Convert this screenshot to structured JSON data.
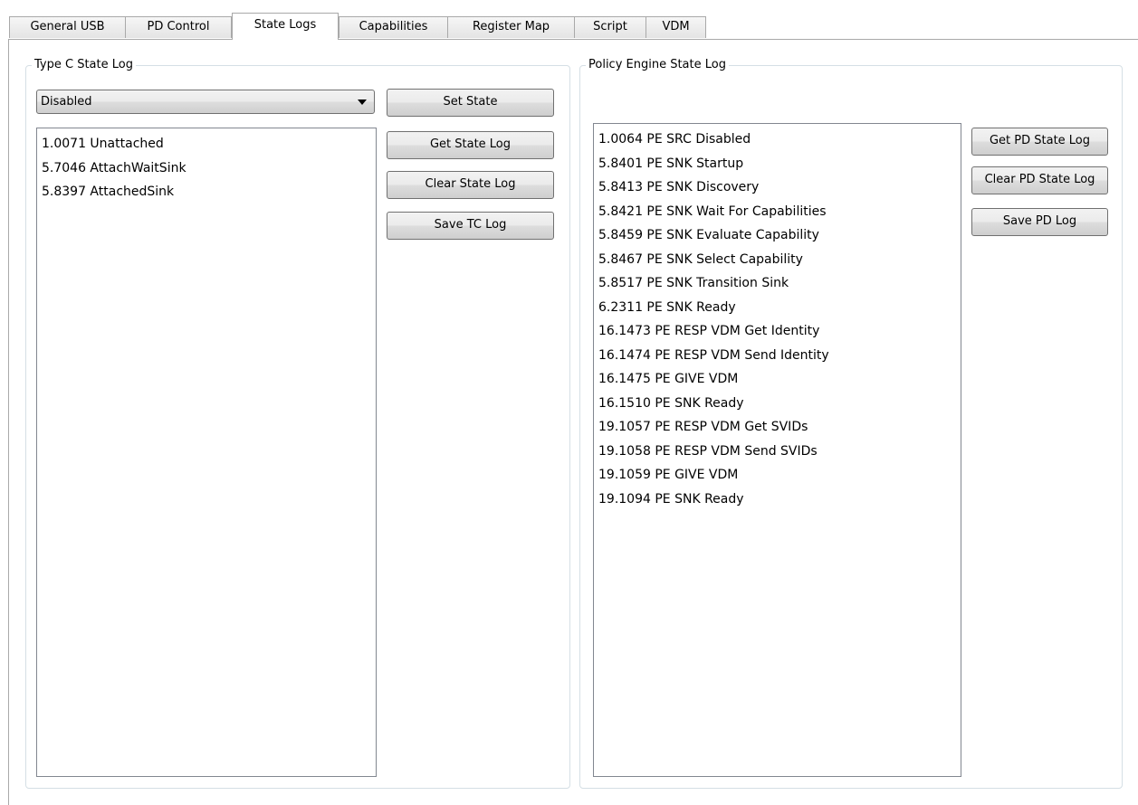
{
  "tabs": [
    {
      "label": "General USB",
      "active": false
    },
    {
      "label": "PD Control",
      "active": false
    },
    {
      "label": "State Logs",
      "active": true
    },
    {
      "label": "Capabilities",
      "active": false
    },
    {
      "label": "Register Map",
      "active": false
    },
    {
      "label": "Script",
      "active": false
    },
    {
      "label": "VDM",
      "active": false
    }
  ],
  "type_c": {
    "title": "Type C State Log",
    "state_select": {
      "selected": "Disabled"
    },
    "buttons": {
      "set_state": "Set State",
      "get_state_log": "Get State Log",
      "clear_state_log": "Clear State Log",
      "save_tc_log": "Save TC Log"
    },
    "log_entries": [
      "1.0071 Unattached",
      "5.7046 AttachWaitSink",
      "5.8397 AttachedSink"
    ]
  },
  "policy_engine": {
    "title": "Policy Engine State Log",
    "buttons": {
      "get_pd_state_log": "Get PD State Log",
      "clear_pd_state_log": "Clear PD State Log",
      "save_pd_log": "Save PD Log"
    },
    "log_entries": [
      "1.0064 PE SRC Disabled",
      "5.8401 PE SNK Startup",
      "5.8413 PE SNK Discovery",
      "5.8421 PE SNK Wait For Capabilities",
      "5.8459 PE SNK Evaluate Capability",
      "5.8467 PE SNK Select Capability",
      "5.8517 PE SNK Transition Sink",
      "6.2311 PE SNK Ready",
      "16.1473 PE RESP VDM Get Identity",
      "16.1474 PE RESP VDM Send Identity",
      "16.1475 PE GIVE VDM",
      "16.1510 PE SNK Ready",
      "19.1057 PE RESP VDM Get SVIDs",
      "19.1058 PE RESP VDM Send SVIDs",
      "19.1059 PE GIVE VDM",
      "19.1094 PE SNK Ready"
    ]
  }
}
